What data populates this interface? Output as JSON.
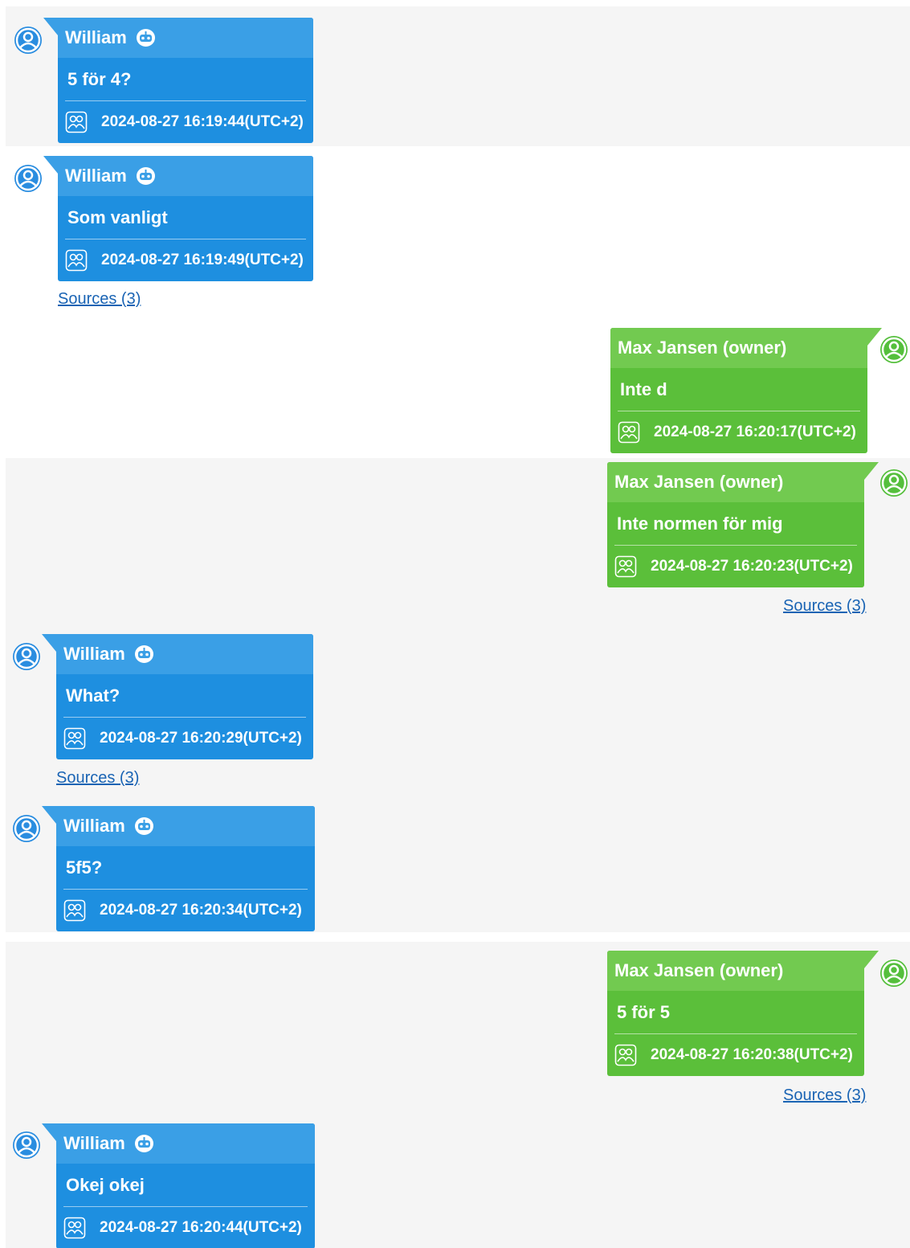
{
  "colors": {
    "incoming_body": "#1e8fe0",
    "incoming_header": "#3a9fe6",
    "outgoing_body": "#5bbf3a",
    "outgoing_header": "#72ca50",
    "incoming_avatar": "#2a8de0",
    "outgoing_avatar": "#55bf3c",
    "link": "#1a64b4",
    "band": "#f5f5f5"
  },
  "icons": {
    "avatar": "user-circle-icon",
    "bot": "robot-icon",
    "group": "group-icon"
  },
  "messages": [
    {
      "sender": "William",
      "direction": "incoming",
      "bot": true,
      "text": "5 för 4?",
      "timestamp": "2024-08-27 16:19:44(UTC+2)"
    },
    {
      "sender": "William",
      "direction": "incoming",
      "bot": true,
      "text": "Som vanligt",
      "timestamp": "2024-08-27 16:19:49(UTC+2)",
      "sources": "Sources (3)"
    },
    {
      "sender": "Max Jansen (owner)",
      "direction": "outgoing",
      "bot": false,
      "text": "Inte d",
      "timestamp": "2024-08-27 16:20:17(UTC+2)"
    },
    {
      "sender": "Max Jansen (owner)",
      "direction": "outgoing",
      "bot": false,
      "text": "Inte normen för mig",
      "timestamp": "2024-08-27 16:20:23(UTC+2)",
      "sources": "Sources (3)"
    },
    {
      "sender": "William",
      "direction": "incoming",
      "bot": true,
      "text": "What?",
      "timestamp": "2024-08-27 16:20:29(UTC+2)",
      "sources": "Sources (3)"
    },
    {
      "sender": "William",
      "direction": "incoming",
      "bot": true,
      "text": "5f5?",
      "timestamp": "2024-08-27 16:20:34(UTC+2)"
    },
    {
      "sender": "Max Jansen (owner)",
      "direction": "outgoing",
      "bot": false,
      "text": "5 för 5",
      "timestamp": "2024-08-27 16:20:38(UTC+2)",
      "sources": "Sources (3)"
    },
    {
      "sender": "William",
      "direction": "incoming",
      "bot": true,
      "text": "Okej okej",
      "timestamp": "2024-08-27 16:20:44(UTC+2)"
    }
  ]
}
